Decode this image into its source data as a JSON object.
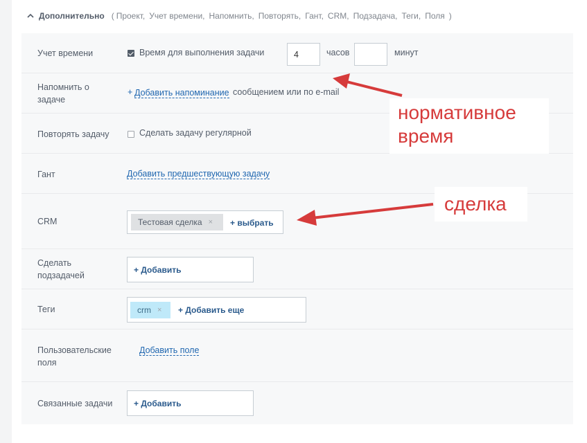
{
  "header": {
    "title": "Дополнительно",
    "open_paren": "(",
    "items": [
      "Проект,",
      "Учет времени,",
      "Напомнить,",
      "Повторять,",
      "Гант,",
      "CRM,",
      "Подзадача,",
      "Теги,",
      "Поля",
      ")"
    ]
  },
  "time_row": {
    "label": "Учет времени",
    "checkbox_label": "Время для выполнения задачи",
    "checked": true,
    "hours_value": "4",
    "hours_unit": "часов",
    "minutes_value": "",
    "minutes_unit": "минут"
  },
  "remind_row": {
    "label_line1": "Напомнить о",
    "label_line2": "задаче",
    "link_plus": "+",
    "link": "Добавить напоминание",
    "suffix": "сообщением или по e-mail"
  },
  "repeat_row": {
    "label": "Повторять задачу",
    "checkbox_label": "Сделать задачу регулярной",
    "checked": false
  },
  "gantt_row": {
    "label": "Гант",
    "link": "Добавить предшествующую задачу"
  },
  "crm_row": {
    "label": "CRM",
    "tag": "Тестовая сделка",
    "tag_remove": "×",
    "select": "+ выбрать"
  },
  "subtask_row": {
    "label_line1": "Сделать",
    "label_line2": "подзадачей",
    "add": "+ Добавить"
  },
  "tags_row": {
    "label": "Теги",
    "tag": "crm",
    "tag_remove": "×",
    "add_more": "+ Добавить еще"
  },
  "fields_row": {
    "label_line1": "Пользовательские",
    "label_line2": "поля",
    "link": "Добавить поле"
  },
  "related_row": {
    "label": "Связанные задачи",
    "add": "+ Добавить"
  },
  "annotations": {
    "normative_line1": "нормативное",
    "normative_line2": "время",
    "deal": "сделка",
    "color": "#d63b3b"
  }
}
